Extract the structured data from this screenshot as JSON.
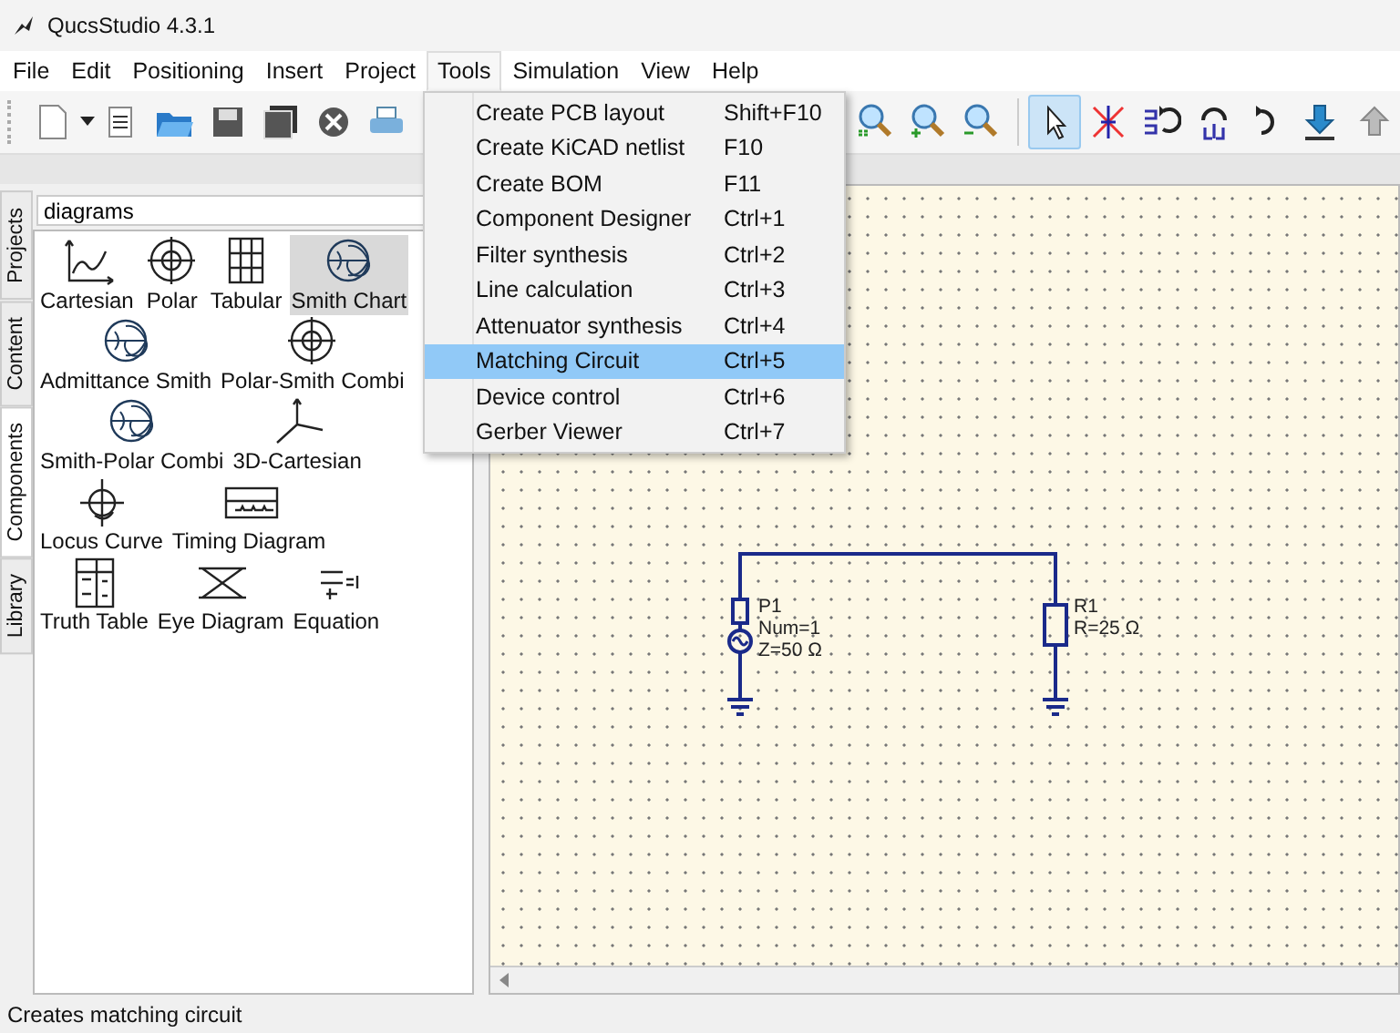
{
  "window": {
    "title": "QucsStudio 4.3.1"
  },
  "menu_bar": [
    {
      "label": "File",
      "selected": false
    },
    {
      "label": "Edit",
      "selected": false
    },
    {
      "label": "Positioning",
      "selected": false
    },
    {
      "label": "Insert",
      "selected": false
    },
    {
      "label": "Project",
      "selected": false
    },
    {
      "label": "Tools",
      "selected": true
    },
    {
      "label": "Simulation",
      "selected": false
    },
    {
      "label": "View",
      "selected": false
    },
    {
      "label": "Help",
      "selected": false
    }
  ],
  "tools_menu": [
    {
      "label": "Create PCB layout",
      "shortcut": "Shift+F10",
      "selected": false
    },
    {
      "label": "Create KiCAD netlist",
      "shortcut": "F10",
      "selected": false
    },
    {
      "label": "Create BOM",
      "shortcut": "F11",
      "selected": false
    },
    {
      "label": "Component Designer",
      "shortcut": "Ctrl+1",
      "selected": false
    },
    {
      "label": "Filter synthesis",
      "shortcut": "Ctrl+2",
      "selected": false
    },
    {
      "label": "Line calculation",
      "shortcut": "Ctrl+3",
      "selected": false
    },
    {
      "label": "Attenuator synthesis",
      "shortcut": "Ctrl+4",
      "selected": false
    },
    {
      "label": "Matching Circuit",
      "shortcut": "Ctrl+5",
      "selected": true
    },
    {
      "label": "Device control",
      "shortcut": "Ctrl+6",
      "selected": false
    },
    {
      "label": "Gerber Viewer",
      "shortcut": "Ctrl+7",
      "selected": false
    }
  ],
  "toolbar_tools": [
    {
      "kind": "zoom11",
      "selected": false
    },
    {
      "kind": "zoomin",
      "selected": false
    },
    {
      "kind": "zoomout",
      "selected": false
    },
    {
      "kind": "select",
      "selected": true
    },
    {
      "kind": "delete",
      "selected": false
    },
    {
      "kind": "mirrorx",
      "selected": false
    },
    {
      "kind": "mirrory",
      "selected": false
    },
    {
      "kind": "rotate",
      "selected": false
    },
    {
      "kind": "down",
      "selected": false
    },
    {
      "kind": "up",
      "selected": false
    }
  ],
  "side_tabs": [
    {
      "label": "Projects",
      "selected": false
    },
    {
      "label": "Content",
      "selected": false
    },
    {
      "label": "Components",
      "selected": true
    },
    {
      "label": "Library",
      "selected": false
    }
  ],
  "palette": {
    "category": "diagrams",
    "items": [
      {
        "label": "Cartesian",
        "kind": "cartesian",
        "selected": false
      },
      {
        "label": "Polar",
        "kind": "polar",
        "selected": false
      },
      {
        "label": "Tabular",
        "kind": "tabular",
        "selected": false
      },
      {
        "label": "Smith Chart",
        "kind": "smith",
        "selected": true
      },
      {
        "label": "Admittance Smith",
        "kind": "smith",
        "selected": false
      },
      {
        "label": "Polar-Smith Combi",
        "kind": "polar",
        "selected": false
      },
      {
        "label": "Smith-Polar Combi",
        "kind": "smith",
        "selected": false
      },
      {
        "label": "3D-Cartesian",
        "kind": "axes3d",
        "selected": false
      },
      {
        "label": "Locus Curve",
        "kind": "locus",
        "selected": false
      },
      {
        "label": "Timing Diagram",
        "kind": "timing",
        "selected": false
      },
      {
        "label": "Truth Table",
        "kind": "truth",
        "selected": false
      },
      {
        "label": "Eye Diagram",
        "kind": "eye",
        "selected": false
      },
      {
        "label": "Equation",
        "kind": "equation",
        "selected": false
      }
    ]
  },
  "schematic": {
    "components": [
      {
        "kind": "port",
        "name": "P1",
        "params": [
          "Num=1",
          "Z=50 Ω"
        ]
      },
      {
        "kind": "resistor",
        "name": "R1",
        "params": [
          "R=25 Ω"
        ]
      }
    ]
  },
  "status_bar": {
    "text": "Creates matching circuit"
  }
}
